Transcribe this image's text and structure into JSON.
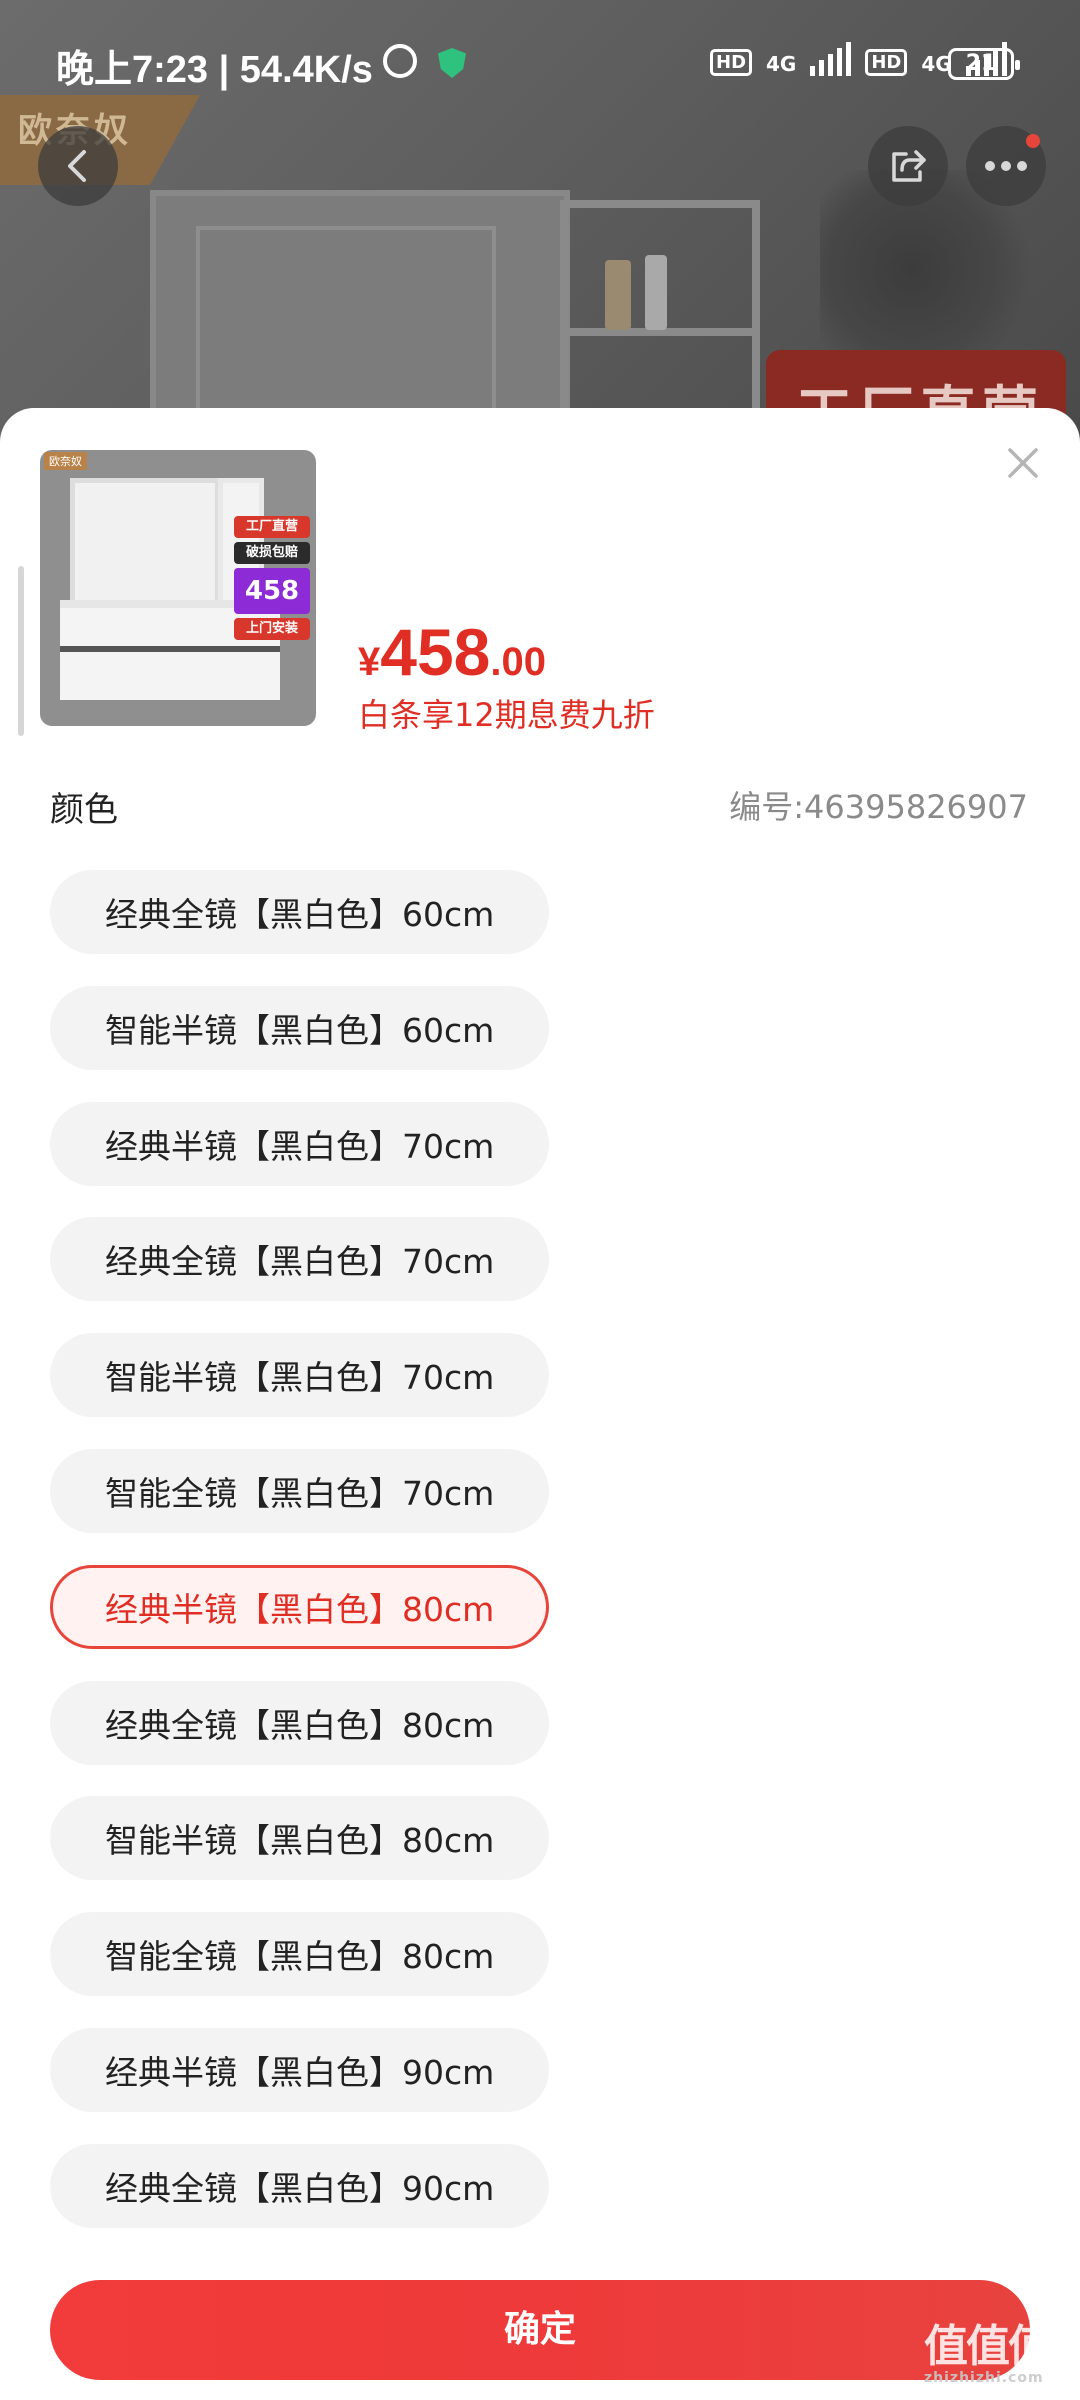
{
  "status_bar": {
    "time": "晚上7:23 | 54.4K/s",
    "hd_label": "HD",
    "net_label": "4G",
    "battery": "21"
  },
  "background": {
    "brand_logo": "欧奈奴",
    "banner_text": "工厂直营"
  },
  "product": {
    "thumb_logo": "欧奈奴",
    "thumb_badges": [
      "工厂直营",
      "破损包赔",
      "458",
      "上门安装"
    ],
    "price_symbol": "¥",
    "price_integer": "458",
    "price_decimal": ".00",
    "promo_text": "白条享12期息费九折"
  },
  "sku_section": {
    "label": "颜色",
    "sku_number": "编号:46395826907",
    "options": [
      {
        "label": "经典全镜【黑白色】60cm",
        "selected": false
      },
      {
        "label": "智能半镜【黑白色】60cm",
        "selected": false
      },
      {
        "label": "经典半镜【黑白色】70cm",
        "selected": false
      },
      {
        "label": "经典全镜【黑白色】70cm",
        "selected": false
      },
      {
        "label": "智能半镜【黑白色】70cm",
        "selected": false
      },
      {
        "label": "智能全镜【黑白色】70cm",
        "selected": false
      },
      {
        "label": "经典半镜【黑白色】80cm",
        "selected": true
      },
      {
        "label": "经典全镜【黑白色】80cm",
        "selected": false
      },
      {
        "label": "智能半镜【黑白色】80cm",
        "selected": false
      },
      {
        "label": "智能全镜【黑白色】80cm",
        "selected": false
      },
      {
        "label": "经典半镜【黑白色】90cm",
        "selected": false
      },
      {
        "label": "经典全镜【黑白色】90cm",
        "selected": false
      }
    ]
  },
  "confirm_label": "确定",
  "watermark": {
    "main": "值值值",
    "sub": "zhizhizhi.com"
  },
  "colors": {
    "accent": "#e02e24",
    "selected_bg": "#fff2f0",
    "option_bg": "#f3f3f3"
  }
}
